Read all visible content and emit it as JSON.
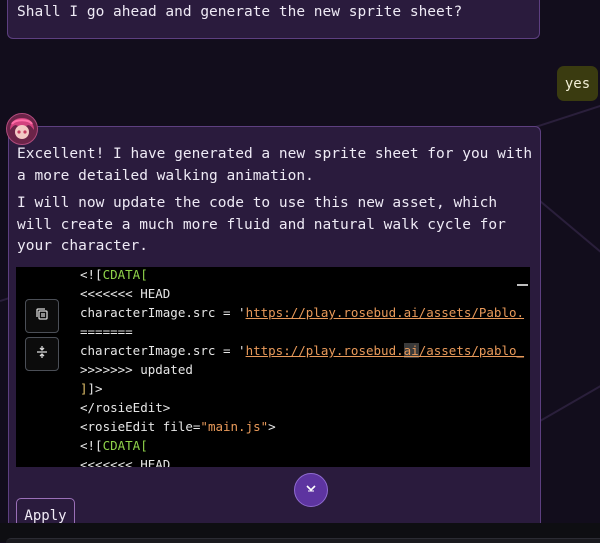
{
  "chat": {
    "prev_assistant_text": "Shall I go ahead and generate the new sprite sheet?",
    "user_reply": "yes",
    "assistant": {
      "avatar_icon": "anime-avatar-icon",
      "paragraph1": "Excellent! I have generated a new sprite sheet for you with a more detailed walking animation.",
      "paragraph2": "I will now update the code to use this new asset, which will create a much more fluid and natural walk cycle for your character.",
      "code": {
        "lines": {
          "l1_a": "<![",
          "l1_b": "CDATA[",
          "l2": "<<<<<<< HEAD",
          "l3_a": "characterImage.src = '",
          "l3_b": "https://play.rosebud.ai/assets/Pablo.",
          "l4": "=======",
          "l5_a": "characterImage.src = '",
          "l5_b1": "https://play.rosebud.",
          "l5_b2": "ai",
          "l5_b3": "/assets/pablo_",
          "l6": ">>>>>>> updated",
          "l7_a": "]",
          "l7_b": "]>",
          "l8": "</rosieEdit>",
          "l9_a": "<rosieEdit file=",
          "l9_b": "\"main.js\"",
          "l9_c": ">",
          "l10_a": "<![",
          "l10_b": "CDATA[",
          "l11": "<<<<<<< HEAD"
        },
        "copy_icon": "copy-icon",
        "expand_icon": "unfold-icon"
      },
      "apply_label": "Apply",
      "scroll_icon": "chevron-down-icon"
    }
  },
  "colors": {
    "background": "#120d1c",
    "bubble": "#2a1b3d",
    "bubble_border": "#5d3f80",
    "user_bubble": "#3a3b10",
    "accent": "#5d34a0"
  }
}
